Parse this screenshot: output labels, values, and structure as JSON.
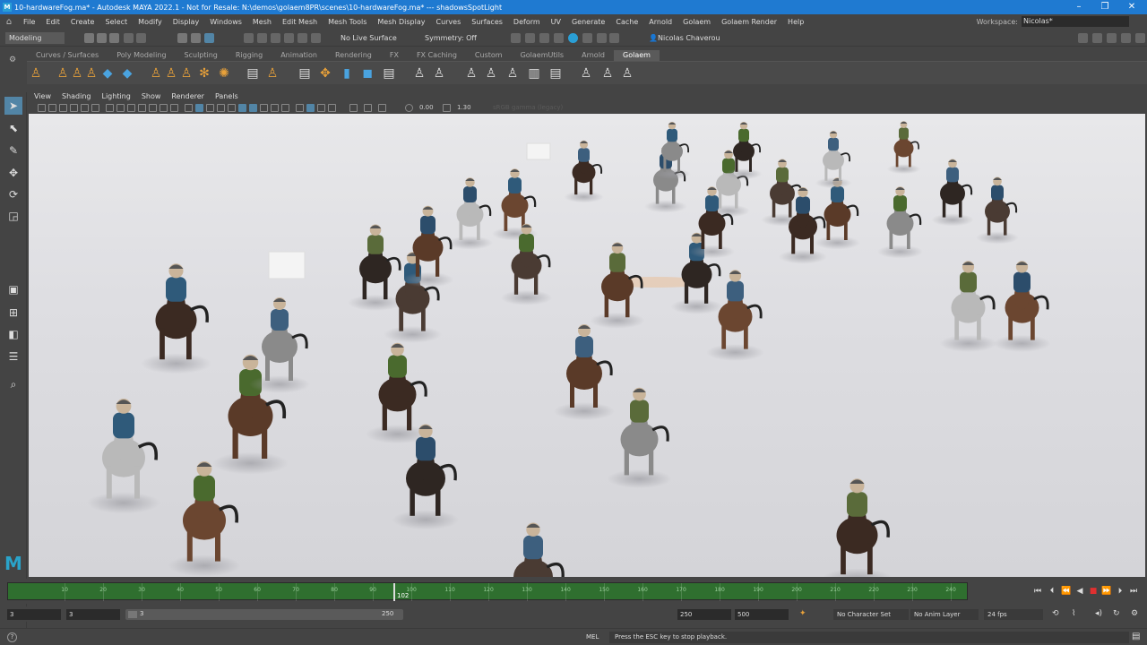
{
  "window": {
    "title": "10-hardwareFog.ma* - Autodesk MAYA 2022.1 - Not for Resale: N:\\demos\\golaem8PR\\scenes\\10-hardwareFog.ma* --- shadowsSpotLight",
    "logo": "M"
  },
  "menu": {
    "items": [
      "File",
      "Edit",
      "Create",
      "Select",
      "Modify",
      "Display",
      "Windows",
      "Mesh",
      "Edit Mesh",
      "Mesh Tools",
      "Mesh Display",
      "Curves",
      "Surfaces",
      "Deform",
      "UV",
      "Generate",
      "Cache",
      "Arnold",
      "Golaem",
      "Golaem Render",
      "Help"
    ],
    "workspace_label": "Workspace:",
    "workspace_value": "Nicolas*"
  },
  "status_line": {
    "mode": "Modeling",
    "live_surface": "No Live Surface",
    "symmetry": "Symmetry: Off",
    "user": "Nicolas Chaverou"
  },
  "shelf": {
    "tabs": [
      "Curves / Surfaces",
      "Poly Modeling",
      "Sculpting",
      "Rigging",
      "Animation",
      "Rendering",
      "FX",
      "FX Caching",
      "Custom",
      "GolaemUtils",
      "Arnold",
      "Golaem"
    ],
    "active_tab": "Golaem"
  },
  "panel": {
    "menus": [
      "View",
      "Shading",
      "Lighting",
      "Show",
      "Renderer",
      "Panels"
    ],
    "exposure": "0.00",
    "gamma": "1.30",
    "color_space": "sRGB gamma (legacy)"
  },
  "timeline": {
    "ticks": [
      "10",
      "20",
      "30",
      "40",
      "50",
      "60",
      "70",
      "80",
      "90",
      "100",
      "110",
      "120",
      "130",
      "140",
      "150",
      "160",
      "170",
      "180",
      "190",
      "200",
      "210",
      "220",
      "230",
      "240"
    ],
    "current_frame": "102"
  },
  "range": {
    "start": "3",
    "inner_start": "3",
    "slider_start": "3",
    "slider_end": "250",
    "end": "250",
    "anim_end": "500",
    "character_set": "No Character Set",
    "anim_layer": "No Anim Layer",
    "fps": "24 fps"
  },
  "command_line": {
    "language": "MEL",
    "message": "Press the ESC key to stop playback."
  },
  "colors": {
    "title_bar": "#1f7ad1",
    "timeline_green": "#2f6f2f",
    "active_tool": "#5285a6",
    "viewport_bg": "#e0e0e3"
  }
}
